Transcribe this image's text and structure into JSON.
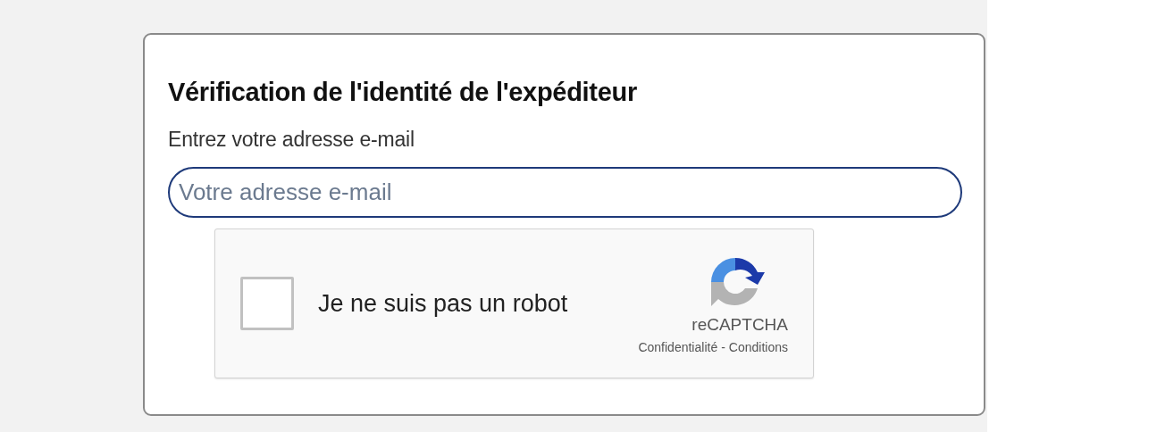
{
  "form": {
    "title": "Vérification de l'identité de l'expéditeur",
    "email_label": "Entrez votre adresse e-mail",
    "email_field": {
      "placeholder": "Votre adresse e-mail"
    }
  },
  "captcha": {
    "checked": false,
    "label": "Je ne suis pas un robot",
    "brand": "reCAPTCHA",
    "privacy_link": "Confidentialité",
    "separator": "-",
    "terms_link": "Conditions"
  }
}
